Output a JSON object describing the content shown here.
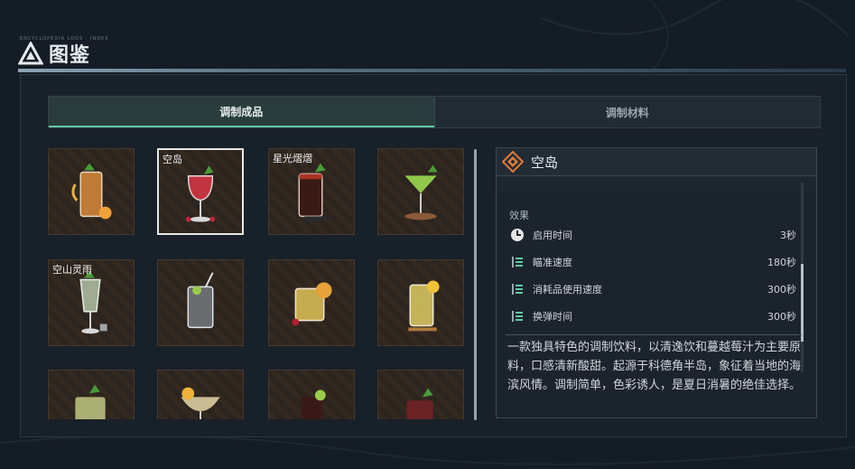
{
  "header": {
    "title": "图鉴",
    "subtitle_tiny": "ENCYCLOPEDIA LOGS · INDEX"
  },
  "tabs": [
    {
      "label": "调制成品",
      "active": true
    },
    {
      "label": "调制材料",
      "active": false
    }
  ],
  "cards": [
    {
      "label": "",
      "drink": "orange-highball",
      "selected": false
    },
    {
      "label": "空岛",
      "drink": "red-goblet",
      "selected": true
    },
    {
      "label": "星光熠熠",
      "drink": "cola-glass",
      "selected": false
    },
    {
      "label": "",
      "drink": "green-martini",
      "selected": false
    },
    {
      "label": "空山灵雨",
      "drink": "mojito-tall",
      "selected": false
    },
    {
      "label": "",
      "drink": "clear-soda",
      "selected": false
    },
    {
      "label": "",
      "drink": "yellow-tumbler",
      "selected": false
    },
    {
      "label": "",
      "drink": "lemon-highball",
      "selected": false
    },
    {
      "label": "",
      "drink": "yellow-mojito",
      "selected": false
    },
    {
      "label": "",
      "drink": "coupe-citrus",
      "selected": false
    },
    {
      "label": "",
      "drink": "dark-short",
      "selected": false
    },
    {
      "label": "",
      "drink": "red-short",
      "selected": false
    }
  ],
  "detail": {
    "name": "空岛",
    "effect_label": "效果",
    "stats": [
      {
        "icon": "clock-icon",
        "label": "启用时间",
        "value": "3秒"
      },
      {
        "icon": "bars-icon",
        "label": "瞄准速度",
        "value": "180秒"
      },
      {
        "icon": "bars-icon",
        "label": "消耗品使用速度",
        "value": "300秒"
      },
      {
        "icon": "bars-icon",
        "label": "换弹时间",
        "value": "300秒"
      }
    ],
    "description": "一款独具特色的调制饮料，以清逸饮和蔓越莓汁为主要原料，口感清新酸甜。起源于科德角半岛，象征着当地的海滨风情。调制简单，色彩诱人，是夏日消暑的绝佳选择。"
  },
  "colors": {
    "accent": "#63c9a2",
    "item_icon": "#e07a3a",
    "card_bg": "#2c241f"
  }
}
